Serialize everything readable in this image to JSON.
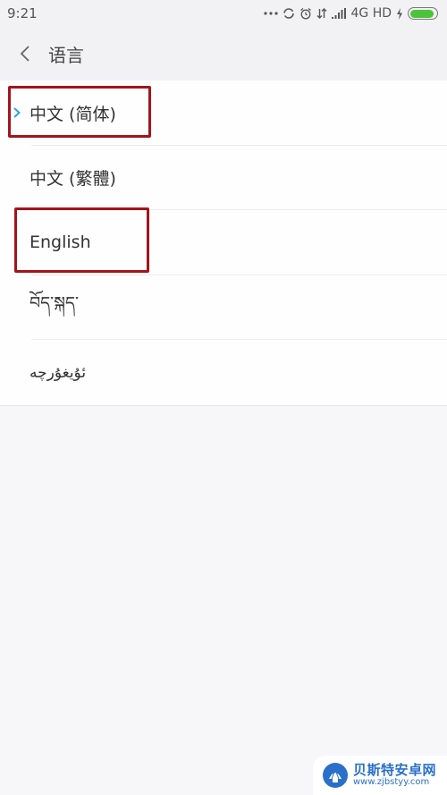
{
  "status_bar": {
    "time": "9:21",
    "icons": [
      "more-dots-icon",
      "sync-icon",
      "alarm-icon",
      "data-transfer-icon",
      "signal-icon"
    ],
    "network": "4G HD",
    "battery_level": 0.9,
    "charging": true
  },
  "header": {
    "back_icon": "chevron-left-icon",
    "title": "语言"
  },
  "languages": [
    {
      "label": "中文 (简体)",
      "selected": true,
      "highlighted": true
    },
    {
      "label": "中文 (繁體)",
      "selected": false,
      "highlighted": false
    },
    {
      "label": "English",
      "selected": false,
      "highlighted": true
    },
    {
      "label": "བོད་སྐད་",
      "selected": false,
      "highlighted": false
    },
    {
      "label": "ئۇيغۇرچە",
      "selected": false,
      "highlighted": false
    }
  ],
  "colors": {
    "accent": "#29a8d8",
    "highlight_box": "#a3141b",
    "battery": "#4bc43a"
  },
  "watermark": {
    "title": "贝斯特安卓网",
    "url": "www.zjbstyy.com"
  }
}
